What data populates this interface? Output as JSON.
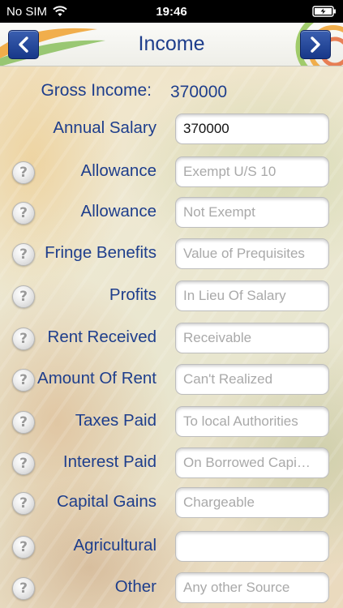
{
  "status_bar": {
    "carrier": "No SIM",
    "time": "19:46",
    "wifi_icon": "wifi-icon",
    "battery_icon": "battery-icon"
  },
  "header": {
    "title": "Income",
    "back_icon": "chevron-left-icon",
    "forward_icon": "chevron-right-icon"
  },
  "gross_income": {
    "label": "Gross Income:",
    "value": "370000"
  },
  "fields": [
    {
      "label": "Annual Salary",
      "value": "370000",
      "placeholder": "",
      "help": false
    },
    {
      "label": "Allowance",
      "value": "",
      "placeholder": "Exempt U/S 10",
      "help": true
    },
    {
      "label": "Allowance",
      "value": "",
      "placeholder": "Not Exempt",
      "help": true
    },
    {
      "label": "Fringe Benefits",
      "value": "",
      "placeholder": "Value of Prequisites",
      "help": true
    },
    {
      "label": "Profits",
      "value": "",
      "placeholder": "In Lieu Of Salary",
      "help": true
    },
    {
      "label": "Rent Received",
      "value": "",
      "placeholder": "Receivable",
      "help": true
    },
    {
      "label": "Amount Of Rent",
      "value": "",
      "placeholder": "Can't Realized",
      "help": true
    },
    {
      "label": "Taxes Paid",
      "value": "",
      "placeholder": "To local Authorities",
      "help": true
    },
    {
      "label": "Interest Paid",
      "value": "",
      "placeholder": "On Borrowed Capi…",
      "help": true
    },
    {
      "label": "Capital Gains",
      "value": "",
      "placeholder": "Chargeable",
      "help": true
    },
    {
      "label": "Agricultural",
      "value": "",
      "placeholder": "",
      "help": true
    },
    {
      "label": "Other",
      "value": "",
      "placeholder": "Any other Source",
      "help": true
    }
  ],
  "help_glyph": "?",
  "colors": {
    "label_blue": "#1e3e8c",
    "nav_button_blue": "#173889",
    "placeholder_gray": "#a9a9a9"
  }
}
